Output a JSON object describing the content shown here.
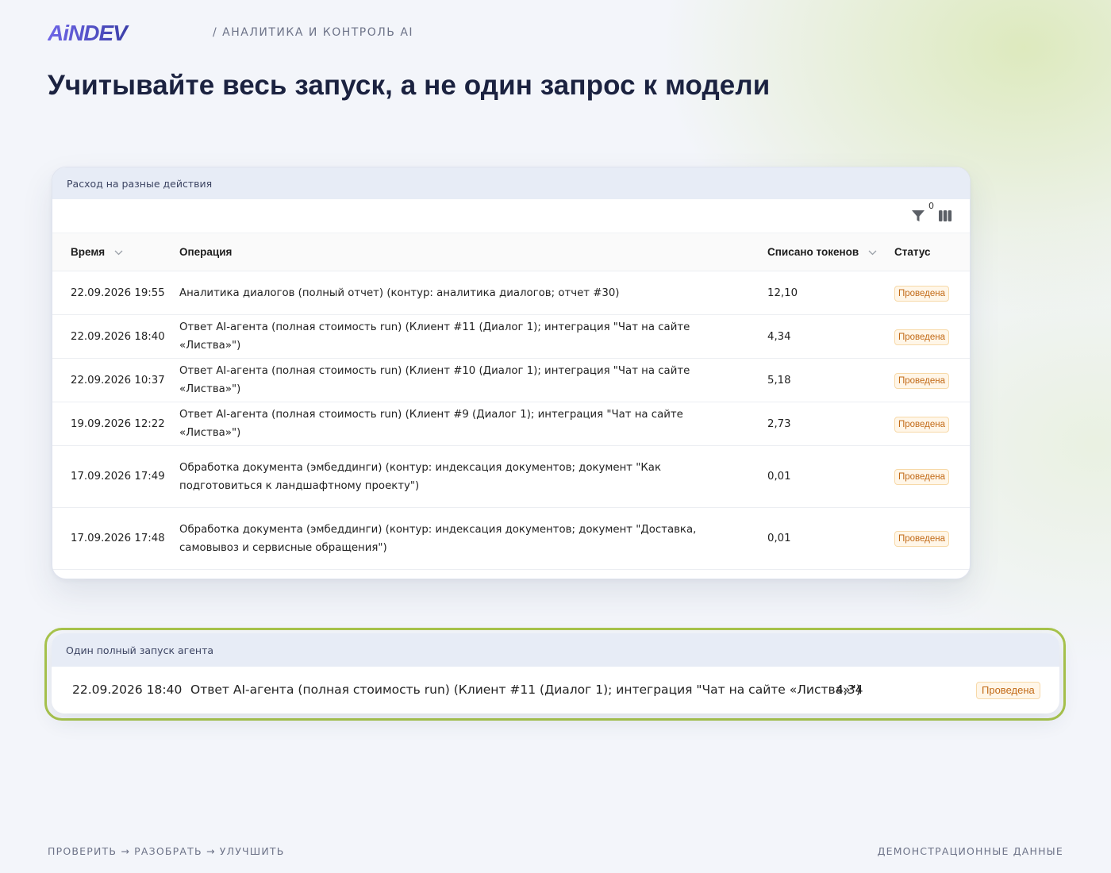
{
  "brand": {
    "logo_text": "AiNDEV",
    "section": "/ АНАЛИТИКА И КОНТРОЛЬ AI"
  },
  "headline": "Учитывайте весь запуск, а не один запрос к модели",
  "colors": {
    "accent_outline": "#a8c44c",
    "badge_text": "#c26a17",
    "badge_bg": "#fff6e8",
    "logo_gradient_start": "#6f66e8",
    "logo_dark": "#14173a"
  },
  "expenses_card": {
    "title": "Расход на разные действия",
    "filter_count": "0",
    "columns": {
      "time": "Время",
      "operation": "Операция",
      "tokens": "Списано токенов",
      "status": "Статус"
    },
    "rows": [
      {
        "time": "22.09.2026 19:55",
        "operation": "Аналитика диалогов (полный отчет) (контур: аналитика диалогов; отчет #30)",
        "tokens": "12,10",
        "status": "Проведена"
      },
      {
        "time": "22.09.2026 18:40",
        "operation": "Ответ AI-агента (полная стоимость run) (Клиент #11 (Диалог 1); интеграция \"Чат на сайте «Листва»\")",
        "tokens": "4,34",
        "status": "Проведена"
      },
      {
        "time": "22.09.2026 10:37",
        "operation": "Ответ AI-агента (полная стоимость run) (Клиент #10 (Диалог 1); интеграция \"Чат на сайте «Листва»\")",
        "tokens": "5,18",
        "status": "Проведена"
      },
      {
        "time": "19.09.2026 12:22",
        "operation": "Ответ AI-агента (полная стоимость run) (Клиент #9 (Диалог 1); интеграция \"Чат на сайте «Листва»\")",
        "tokens": "2,73",
        "status": "Проведена"
      },
      {
        "time": "17.09.2026 17:49",
        "operation": "Обработка документа (эмбеддинги) (контур: индексация документов; документ \"Как подготовиться к ландшафтному проекту\")",
        "tokens": "0,01",
        "status": "Проведена"
      },
      {
        "time": "17.09.2026 17:48",
        "operation": "Обработка документа (эмбеддинги) (контур: индексация документов; документ \"Доставка, самовывоз и сервисные обращения\")",
        "tokens": "0,01",
        "status": "Проведена"
      }
    ]
  },
  "run_card": {
    "title": "Один полный запуск агента",
    "row": {
      "time": "22.09.2026 18:40",
      "operation": "Ответ AI-агента (полная стоимость run) (Клиент #11 (Диалог 1); интеграция \"Чат на сайте «Листва»\")",
      "tokens": "4,34",
      "status": "Проведена"
    }
  },
  "footer": {
    "left": "ПРОВЕРИТЬ → РАЗОБРАТЬ → УЛУЧШИТЬ",
    "right": "ДЕМОНСТРАЦИОННЫЕ ДАННЫЕ"
  }
}
